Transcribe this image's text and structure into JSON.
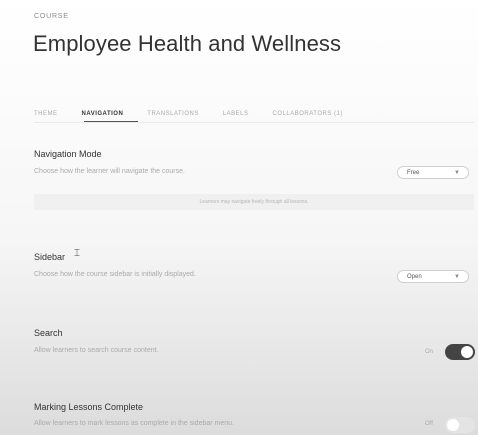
{
  "header": {
    "eyebrow": "COURSE",
    "title": "Employee Health and Wellness"
  },
  "tabs": [
    {
      "label": "THEME",
      "active": false
    },
    {
      "label": "NAVIGATION",
      "active": true
    },
    {
      "label": "TRANSLATIONS",
      "active": false
    },
    {
      "label": "LABELS",
      "active": false
    },
    {
      "label": "COLLABORATORS (1)",
      "active": false
    }
  ],
  "navigation_mode": {
    "title": "Navigation Mode",
    "description": "Choose how the learner will navigate the course.",
    "select_value": "Free",
    "info": "Learners may navigate freely through all lessons."
  },
  "sidebar": {
    "title": "Sidebar",
    "description": "Choose how the course sidebar is initially displayed.",
    "select_value": "Open"
  },
  "search": {
    "title": "Search",
    "description": "Allow learners to search course content.",
    "toggle_label": "On",
    "enabled": true
  },
  "marking": {
    "title": "Marking Lessons Complete",
    "description": "Allow learners to mark lessons as complete in the sidebar menu.",
    "toggle_label": "Off",
    "enabled": false
  },
  "colors": {
    "text_dark": "#333333",
    "text_muted": "#aaaaaa",
    "toggle_on": "#444444",
    "toggle_off": "#e4e4e4"
  },
  "icons": {
    "select": "chevron-down-icon",
    "cursor": "text-cursor-icon"
  }
}
